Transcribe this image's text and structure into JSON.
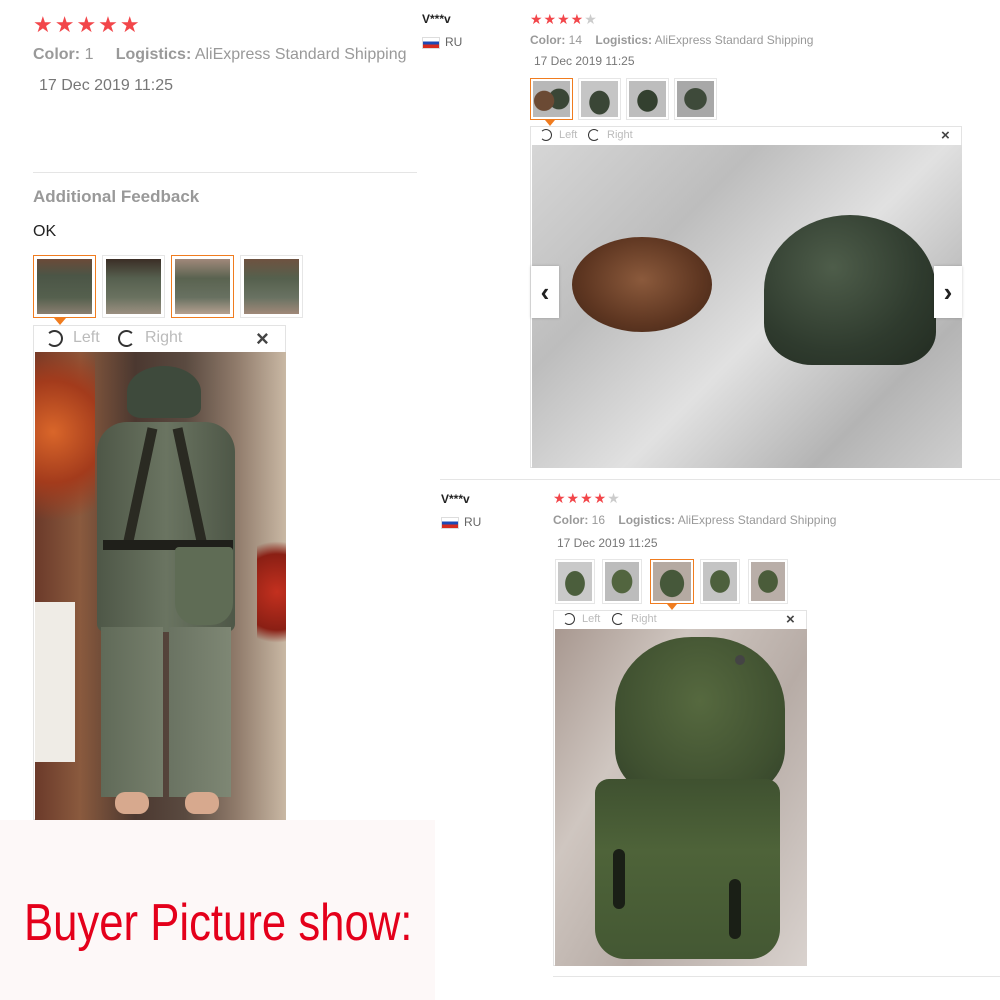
{
  "colors": {
    "star": "#f2464a",
    "accent": "#f07c1f",
    "banner_text": "#e4001b"
  },
  "review1": {
    "stars": "★★★★★",
    "color_label": "Color:",
    "color_value": "1",
    "logistics_label": "Logistics:",
    "logistics_value": "AliExpress Standard Shipping",
    "date": "17 Dec 2019 11:25",
    "additional_heading": "Additional Feedback",
    "additional_text": "OK",
    "viewer": {
      "left_label": "Left",
      "right_label": "Right",
      "close": "×"
    }
  },
  "review2": {
    "user": "V***v",
    "country": "RU",
    "stars_on": "★★★★",
    "stars_off": "★",
    "color_label": "Color:",
    "color_value": "14",
    "logistics_label": "Logistics:",
    "logistics_value": "AliExpress Standard Shipping",
    "date": "17 Dec 2019 11:25",
    "viewer": {
      "left_label": "Left",
      "right_label": "Right",
      "close": "×",
      "prev": "‹",
      "next": "›"
    }
  },
  "review3": {
    "user": "V***v",
    "country": "RU",
    "stars_on": "★★★★",
    "stars_off": "★",
    "color_label": "Color:",
    "color_value": "16",
    "logistics_label": "Logistics:",
    "logistics_value": "AliExpress Standard Shipping",
    "date": "17 Dec 2019 11:25",
    "viewer": {
      "left_label": "Left",
      "right_label": "Right",
      "close": "×"
    }
  },
  "banner": {
    "text": "Buyer Picture show:"
  }
}
